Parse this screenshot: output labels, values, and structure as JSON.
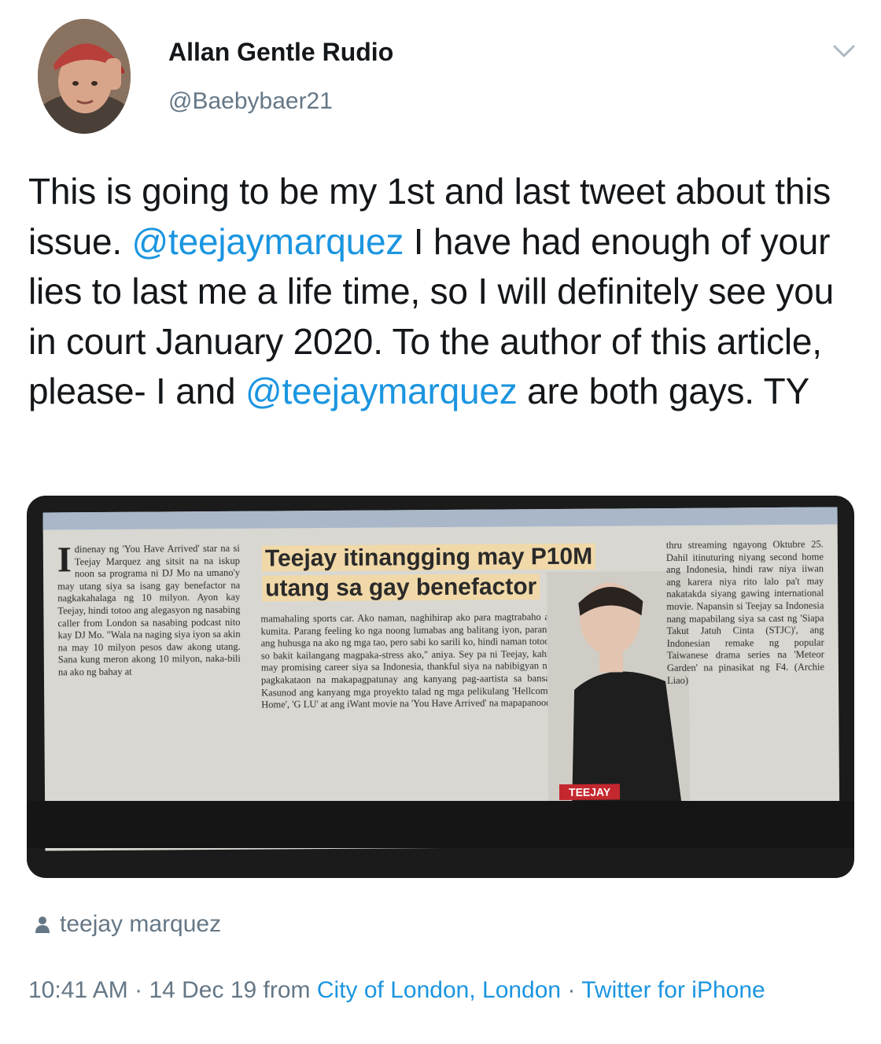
{
  "author": {
    "name": "Allan Gentle Rudio",
    "handle": "@Baebybaer21"
  },
  "tweet": {
    "segments": [
      "This is going to be my 1st and last tweet about this issue. ",
      "@teejaymarquez",
      " I have had enough of your lies to last me a life time, so I will definitely see you in court January 2020. To the author of this article, please- I and ",
      "@teejaymarquez",
      " are both gays. TY"
    ]
  },
  "media": {
    "headline_line1": "Teejay itinangging may P10M",
    "headline_line2": "utang sa gay benefactor",
    "caption": "TEEJAY",
    "dropcap": "I",
    "col1": "dinenay ng 'You Have Arrived' star na si Teejay Marquez ang sitsit na na iskup noon sa programa ni DJ Mo na umano'y may utang siya sa isang gay benefactor na nagkakahalaga ng 10 milyon. Ayon kay Teejay, hindi totoo ang alegasyon ng nasabing caller from London sa nasabing podcast nito kay DJ Mo. \"Wala na naging siya iyon sa akin na may 10 milyon pesos daw akong utang. Sana kung meron akong 10 milyon, naka-bili na ako ng bahay at",
    "col2": "mamahaling sports car. Ako naman, naghihirap ako para magtrabaho at kumita. Parang feeling ko nga noong lumabas ang balitang iyon, parang ang huhusga na ako ng mga tao, pero sabi ko sarili ko, hindi naman totoo, so bakit kailangang magpaka-stress ako,\" aniya. Sey pa ni Teejay, kahit may promising career siya sa Indonesia, thankful siya na nabibigyan ng pagkakataon na makapagpatunay ang kanyang pag-aartista sa bansa. Kasunod ang kanyang mga proyekto talad ng mga pelikulang 'Hellcome Home', 'G LU' at ang iWant movie na 'You Have Arrived' na mapapanood",
    "col3": "thru streaming ngayong Oktubre 25. Dahil itinuturing niyang second home ang Indonesia, hindi raw niya iiwan ang karera niya rito lalo pa't may nakatakda siyang gawing international movie. Napansin si Teejay sa Indonesia nang mapabilang siya sa cast ng 'Siapa Takut Jatuh Cinta (STJC)', ang Indonesian remake ng popular Taiwanese drama series na 'Meteor Garden' na pinasikat ng F4. (Archie Liao)"
  },
  "tagged": "teejay marquez",
  "footer": {
    "time": "10:41 AM",
    "sep1": " · ",
    "date": "14 Dec 19",
    "from_label": " from ",
    "location": "City of London, London",
    "sep2": " · ",
    "client": "Twitter for iPhone"
  },
  "colors": {
    "link": "#1b95e0",
    "secondary": "#657786",
    "text": "#14171a"
  }
}
